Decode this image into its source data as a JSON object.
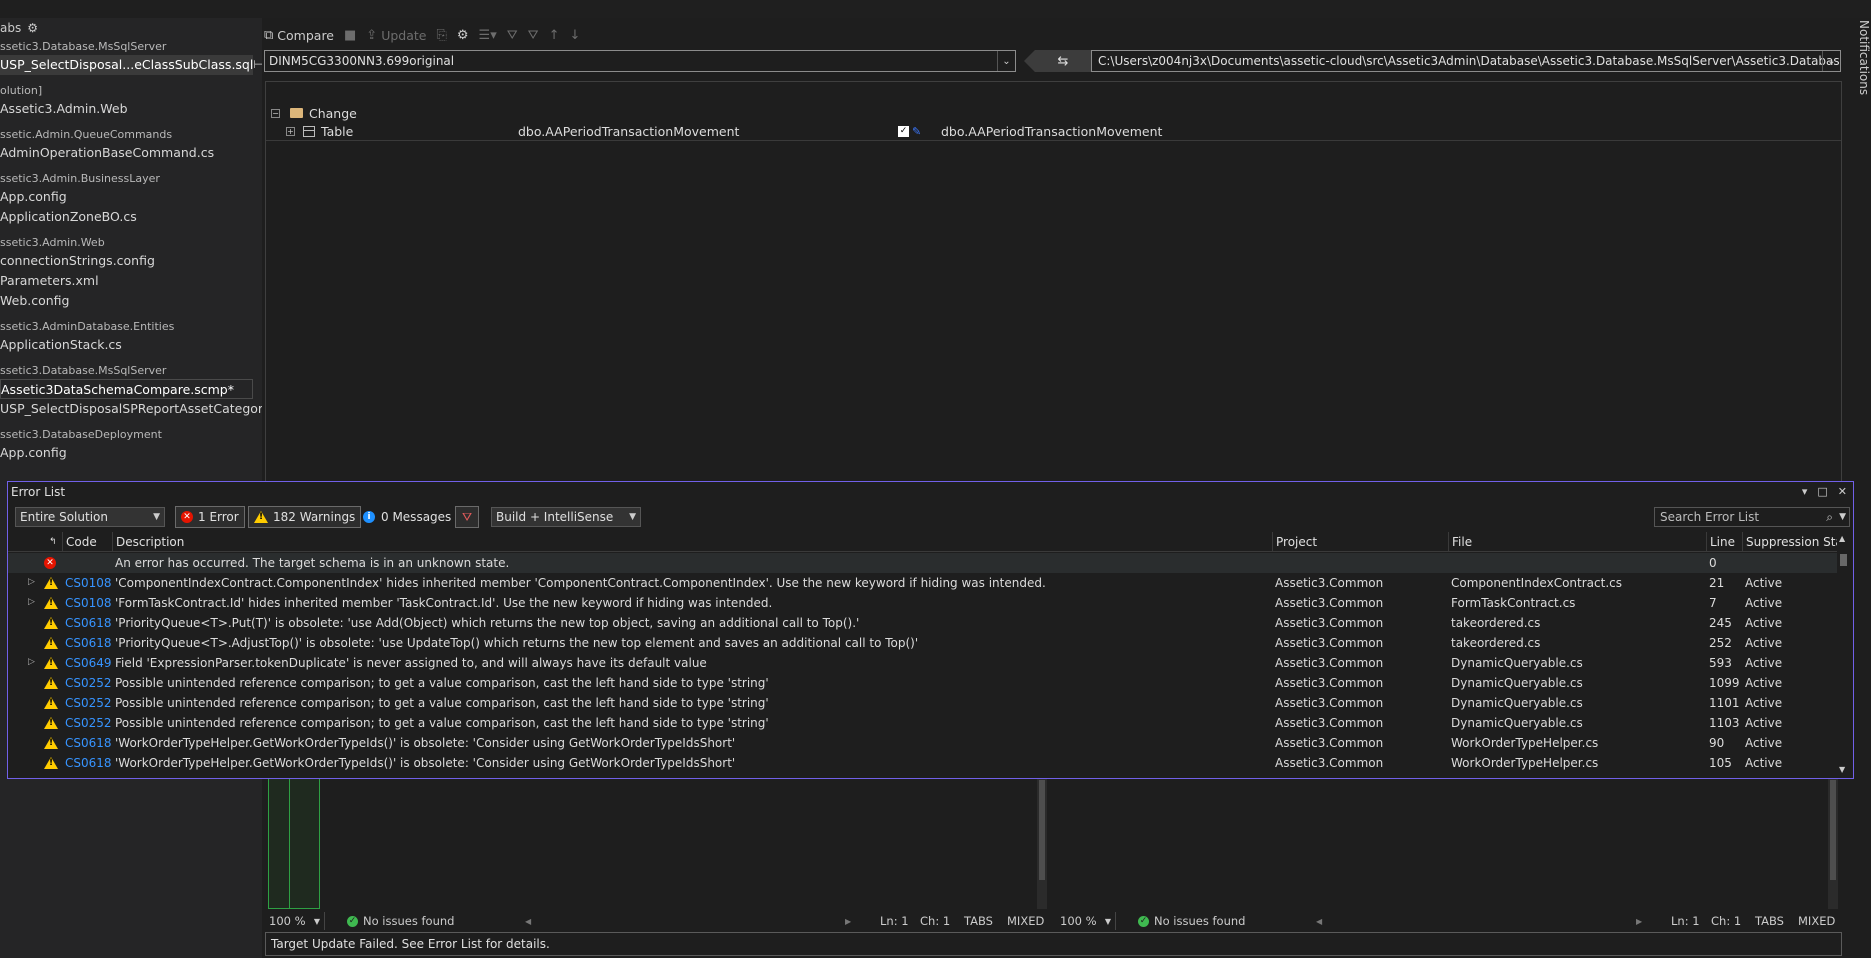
{
  "notifications_label": "Notifications",
  "left_panel": {
    "header": "abs",
    "group_top": "ssetic3.Database.MsSqlServer",
    "active_tab": "USP_SelectDisposal...eClassSubClass.sql",
    "items": [
      {
        "kind": "group",
        "text": "olution]"
      },
      {
        "kind": "file",
        "text": "Assetic3.Admin.Web"
      },
      {
        "kind": "group",
        "text": "ssetic.Admin.QueueCommands"
      },
      {
        "kind": "file",
        "text": "AdminOperationBaseCommand.cs"
      },
      {
        "kind": "group",
        "text": "ssetic3.Admin.BusinessLayer"
      },
      {
        "kind": "file",
        "text": "App.config"
      },
      {
        "kind": "file",
        "text": "ApplicationZoneBO.cs"
      },
      {
        "kind": "group",
        "text": "ssetic3.Admin.Web"
      },
      {
        "kind": "file",
        "text": "connectionStrings.config"
      },
      {
        "kind": "file",
        "text": "Parameters.xml"
      },
      {
        "kind": "file",
        "text": "Web.config"
      },
      {
        "kind": "group",
        "text": "ssetic3.AdminDatabase.Entities"
      },
      {
        "kind": "file",
        "text": "ApplicationStack.cs"
      },
      {
        "kind": "group",
        "text": "ssetic3.Database.MsSqlServer"
      },
      {
        "kind": "boxed",
        "text": "Assetic3DataSchemaCompare.scmp*"
      },
      {
        "kind": "file",
        "text": "USP_SelectDisposalSPReportAssetCategory.sql"
      },
      {
        "kind": "group",
        "text": "ssetic3.DatabaseDeployment"
      },
      {
        "kind": "file",
        "text": "App.config"
      }
    ]
  },
  "toolbar": {
    "compare": "Compare",
    "update": "Update"
  },
  "source": {
    "value": "DINM5CG3300NN3.699original"
  },
  "target": {
    "value": "C:\\Users\\z004nj3x\\Documents\\assetic-cloud\\src\\Assetic3Admin\\Database\\Assetic3.Database.MsSqlServer\\Assetic3.Database.MsSqlSer..."
  },
  "results": {
    "group_label": "Change",
    "row_type": "Table",
    "source_object": "dbo.AAPeriodTransactionMovement",
    "target_object": "dbo.AAPeriodTransactionMovement"
  },
  "error_list": {
    "title": "Error List",
    "scope": "Entire Solution",
    "errors_label": "1 Error",
    "warnings_label": "182 Warnings",
    "messages_label": "0 Messages",
    "build_filter": "Build + IntelliSense",
    "search_placeholder": "Search Error List",
    "columns": {
      "code": "Code",
      "description": "Description",
      "project": "Project",
      "file": "File",
      "line": "Line",
      "suppression": "Suppression Stat"
    },
    "rows": [
      {
        "severity": "error",
        "expandable": false,
        "code": "",
        "description": "An error has occurred. The target schema is in an unknown state.",
        "project": "",
        "file": "",
        "line": "0",
        "suppression": ""
      },
      {
        "severity": "warning",
        "expandable": true,
        "code": "CS0108",
        "description": "'ComponentIndexContract.ComponentIndex' hides inherited member 'ComponentContract.ComponentIndex'. Use the new keyword if hiding was intended.",
        "project": "Assetic3.Common",
        "file": "ComponentIndexContract.cs",
        "line": "21",
        "suppression": "Active"
      },
      {
        "severity": "warning",
        "expandable": true,
        "code": "CS0108",
        "description": "'FormTaskContract.Id' hides inherited member 'TaskContract.Id'. Use the new keyword if hiding was intended.",
        "project": "Assetic3.Common",
        "file": "FormTaskContract.cs",
        "line": "7",
        "suppression": "Active"
      },
      {
        "severity": "warning",
        "expandable": false,
        "code": "CS0618",
        "description": "'PriorityQueue<T>.Put(T)' is obsolete: 'use Add(Object) which returns the new top object, saving an additional call to Top().'",
        "project": "Assetic3.Common",
        "file": "takeordered.cs",
        "line": "245",
        "suppression": "Active"
      },
      {
        "severity": "warning",
        "expandable": false,
        "code": "CS0618",
        "description": "'PriorityQueue<T>.AdjustTop()' is obsolete: 'use UpdateTop() which returns the new top element and saves an additional call to Top()'",
        "project": "Assetic3.Common",
        "file": "takeordered.cs",
        "line": "252",
        "suppression": "Active"
      },
      {
        "severity": "warning",
        "expandable": true,
        "code": "CS0649",
        "description": "Field 'ExpressionParser.tokenDuplicate' is never assigned to, and will always have its default value",
        "project": "Assetic3.Common",
        "file": "DynamicQueryable.cs",
        "line": "593",
        "suppression": "Active"
      },
      {
        "severity": "warning",
        "expandable": false,
        "code": "CS0252",
        "description": "Possible unintended reference comparison; to get a value comparison, cast the left hand side to type 'string'",
        "project": "Assetic3.Common",
        "file": "DynamicQueryable.cs",
        "line": "1099",
        "suppression": "Active"
      },
      {
        "severity": "warning",
        "expandable": false,
        "code": "CS0252",
        "description": "Possible unintended reference comparison; to get a value comparison, cast the left hand side to type 'string'",
        "project": "Assetic3.Common",
        "file": "DynamicQueryable.cs",
        "line": "1101",
        "suppression": "Active"
      },
      {
        "severity": "warning",
        "expandable": false,
        "code": "CS0252",
        "description": "Possible unintended reference comparison; to get a value comparison, cast the left hand side to type 'string'",
        "project": "Assetic3.Common",
        "file": "DynamicQueryable.cs",
        "line": "1103",
        "suppression": "Active"
      },
      {
        "severity": "warning",
        "expandable": false,
        "code": "CS0618",
        "description": "'WorkOrderTypeHelper.GetWorkOrderTypeIds()' is obsolete: 'Consider using GetWorkOrderTypeIdsShort'",
        "project": "Assetic3.Common",
        "file": "WorkOrderTypeHelper.cs",
        "line": "90",
        "suppression": "Active"
      },
      {
        "severity": "warning",
        "expandable": false,
        "code": "CS0618",
        "description": "'WorkOrderTypeHelper.GetWorkOrderTypeIds()' is obsolete: 'Consider using GetWorkOrderTypeIdsShort'",
        "project": "Assetic3.Common",
        "file": "WorkOrderTypeHelper.cs",
        "line": "105",
        "suppression": "Active"
      }
    ]
  },
  "editor_left_status": {
    "zoom": "100 %",
    "issues": "No issues found",
    "ln": "Ln: 1",
    "ch": "Ch: 1",
    "tabs": "TABS",
    "mixed": "MIXED"
  },
  "editor_right_status": {
    "zoom": "100 %",
    "issues": "No issues found",
    "ln": "Ln: 1",
    "ch": "Ch: 1",
    "tabs": "TABS",
    "mixed": "MIXED"
  },
  "output_message": "Target Update Failed. See Error List for details."
}
